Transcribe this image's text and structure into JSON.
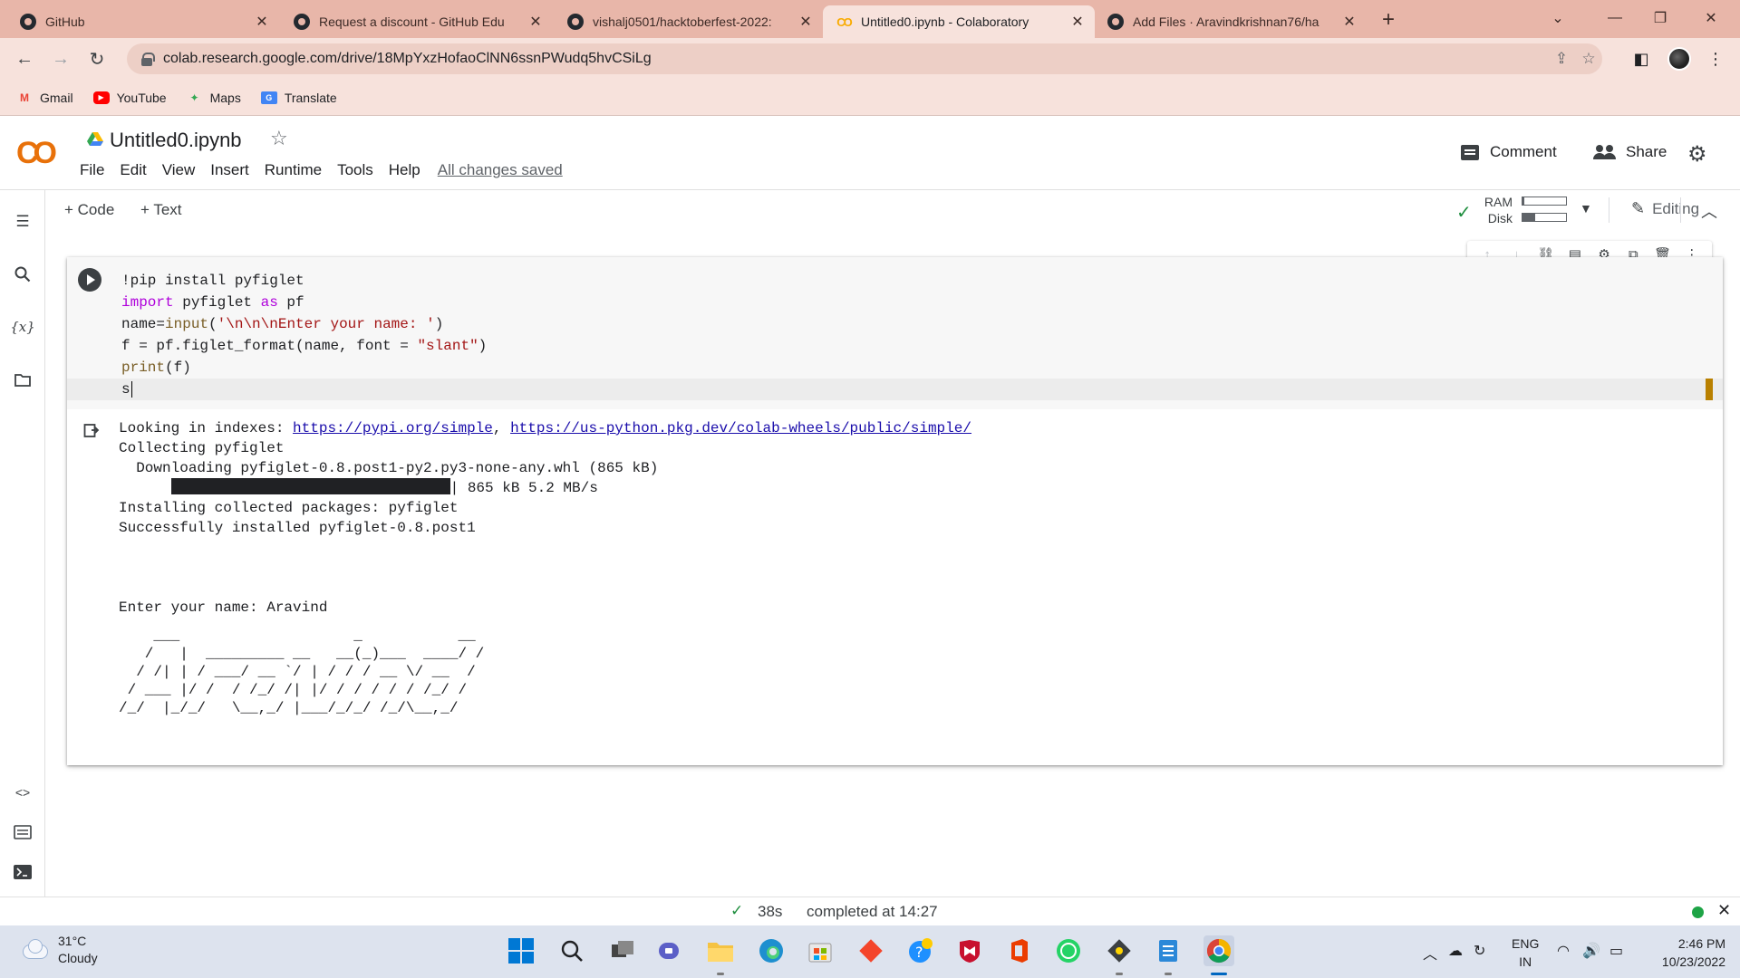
{
  "browser": {
    "tabs": [
      {
        "title": "GitHub",
        "icon": "github-icon",
        "active": false
      },
      {
        "title": "Request a discount - GitHub Edu",
        "icon": "github-icon",
        "active": false
      },
      {
        "title": "vishalj0501/hacktoberfest-2022:",
        "icon": "github-icon",
        "active": false
      },
      {
        "title": "Untitled0.ipynb - Colaboratory",
        "icon": "colab-icon",
        "active": true
      },
      {
        "title": "Add Files · Aravindkrishnan76/ha",
        "icon": "github-icon",
        "active": false
      }
    ],
    "new_tab": "+",
    "url": "colab.research.google.com/drive/18MpYxzHofaoClNN6ssnPWudq5hvCSiLg",
    "bookmarks": [
      {
        "label": "Gmail",
        "icon": "gmail-icon"
      },
      {
        "label": "YouTube",
        "icon": "youtube-icon"
      },
      {
        "label": "Maps",
        "icon": "maps-icon"
      },
      {
        "label": "Translate",
        "icon": "translate-icon"
      }
    ]
  },
  "colab": {
    "logo": "CO",
    "notebook_title": "Untitled0.ipynb",
    "menu": [
      "File",
      "Edit",
      "View",
      "Insert",
      "Runtime",
      "Tools",
      "Help"
    ],
    "save_status": "All changes saved",
    "comment_label": "Comment",
    "share_label": "Share",
    "add_code_label": "+ Code",
    "add_text_label": "+ Text",
    "ram_label": "RAM",
    "disk_label": "Disk",
    "ram_usage": 0.04,
    "disk_usage": 0.3,
    "editing_label": "Editing",
    "status": {
      "time": "38s",
      "completed": "completed at 14:27"
    }
  },
  "cell": {
    "output": {
      "line1_prefix": "Looking in indexes: ",
      "link1": "https://pypi.org/simple",
      "sep": ", ",
      "link2": "https://us-python.pkg.dev/colab-wheels/public/simple/",
      "line2": "Collecting pyfiglet",
      "line3": "  Downloading pyfiglet-0.8.post1-py2.py3-none-any.whl (865 kB)",
      "progress_label": "| 865 kB 5.2 MB/s",
      "progress": 1.0,
      "line5": "Installing collected packages: pyfiglet",
      "line6": "Successfully installed pyfiglet-0.8.post1",
      "prompt": "Enter your name: Aravind",
      "ascii_art": "    ___                    _           __\n   /   |  _________ __   __(_)___  ____/ /\n  / /| | / ___/ __ `/ | / / / __ \\/ __  / \n / ___ |/ /  / /_/ /| |/ / / / / / /_/ /  \n/_/  |_/_/   \\__,_/ |___/_/_/ /_/\\__,_/   "
    }
  },
  "taskbar": {
    "weather_temp": "31°C",
    "weather_desc": "Cloudy",
    "lang_top": "ENG",
    "lang_bottom": "IN",
    "time": "2:46 PM",
    "date": "10/23/2022"
  },
  "colors": {
    "tab_strip": "#e8b6a9",
    "toolbar": "#f7e2dc",
    "colab_orange": "#f9ab00",
    "link": "#1a0dab",
    "success_green": "#1e8e3e"
  }
}
